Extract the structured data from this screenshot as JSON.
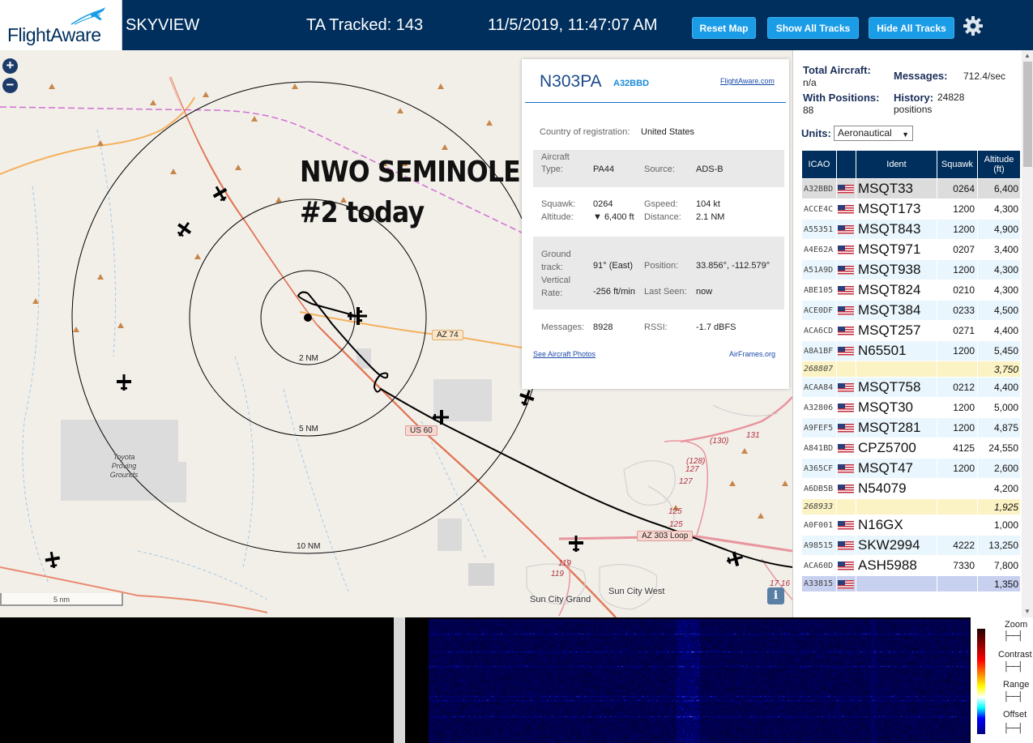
{
  "header": {
    "logo_text": "FlightAware",
    "app_name": "SKYVIEW",
    "tracked": "TA Tracked: 143",
    "clock": "11/5/2019, 11:47:07 AM",
    "buttons": {
      "reset": "Reset Map",
      "show": "Show All Tracks",
      "hide": "Hide All Tracks"
    }
  },
  "map": {
    "zoom_in": "+",
    "zoom_out": "−",
    "annotation_line1": "NWO SEMINOLE",
    "annotation_line2": "#2 today",
    "ring_labels": {
      "r2": "2 NM",
      "r5": "5 NM",
      "r10": "10 NM"
    },
    "roads": {
      "az74": "AZ 74",
      "us60": "US 60",
      "az303": "AZ 303 Loop"
    },
    "route_numbers": {
      "r130": "(130)",
      "r131": "131",
      "r128": "(128)",
      "r127a": "127",
      "r127b": "127",
      "r125a": "125",
      "r125b": "125",
      "r119a": "119",
      "r119b": "119",
      "r1716": "17 16"
    },
    "towns": {
      "toyota": "Toyota Proving Grounds",
      "sun_city_grand": "Sun City Grand",
      "sun_city_west": "Sun City West"
    },
    "scale": "5 nm",
    "info": "i"
  },
  "popup": {
    "registration": "N303PA",
    "hex": "A32BBD",
    "link": "FlightAware.com",
    "country_label": "Country of registration:",
    "country": "United States",
    "aircraft_type_label": "Aircraft Type:",
    "aircraft_type": "PA44",
    "source_label": "Source:",
    "source": "ADS-B",
    "squawk_label": "Squawk:",
    "squawk": "0264",
    "gspeed_label": "Gspeed:",
    "gspeed": "104 kt",
    "altitude_label": "Altitude:",
    "altitude": "▼ 6,400 ft",
    "distance_label": "Distance:",
    "distance": "2.1 NM",
    "ground_track_label": "Ground track:",
    "ground_track": "91° (East)",
    "position_label": "Position:",
    "position": "33.856°, -112.579°",
    "vertical_rate_label": "Vertical Rate:",
    "vertical_rate": "-256 ft/min",
    "last_seen_label": "Last Seen:",
    "last_seen": "now",
    "messages_label": "Messages:",
    "messages": "8928",
    "rssi_label": "RSSI:",
    "rssi": "-1.7 dBFS",
    "photos_link": "See Aircraft Photos",
    "airframes_link": "AirFrames.org"
  },
  "stats": {
    "total_label": "Total Aircraft:",
    "total": "n/a",
    "messages_label": "Messages:",
    "messages": "712.4/sec",
    "positions_label": "With Positions:",
    "positions": "88",
    "history_label": "History:",
    "history": "24828 positions",
    "units_label": "Units:",
    "units_value": "Aeronautical"
  },
  "table": {
    "headers": {
      "icao": "ICAO",
      "flag": "",
      "ident": "Ident",
      "squawk": "Squawk",
      "altitude": "Altitude (ft)"
    },
    "rows": [
      {
        "icao": "A32BBD",
        "ident": "MSQT33",
        "squawk": "0264",
        "alt": "6,400"
      },
      {
        "icao": "ACCE4C",
        "ident": "MSQT173",
        "squawk": "1200",
        "alt": "4,300"
      },
      {
        "icao": "A55351",
        "ident": "MSQT843",
        "squawk": "1200",
        "alt": "4,900"
      },
      {
        "icao": "A4E62A",
        "ident": "MSQT971",
        "squawk": "0207",
        "alt": "3,400"
      },
      {
        "icao": "A51A9D",
        "ident": "MSQT938",
        "squawk": "1200",
        "alt": "4,300"
      },
      {
        "icao": "ABE105",
        "ident": "MSQT824",
        "squawk": "0210",
        "alt": "4,300"
      },
      {
        "icao": "ACE0DF",
        "ident": "MSQT384",
        "squawk": "0233",
        "alt": "4,500"
      },
      {
        "icao": "ACA6CD",
        "ident": "MSQT257",
        "squawk": "0271",
        "alt": "4,400"
      },
      {
        "icao": "A8A1BF",
        "ident": "N65501",
        "squawk": "1200",
        "alt": "5,450"
      },
      {
        "icao": "268807",
        "ident": "",
        "squawk": "",
        "alt": "3,750"
      },
      {
        "icao": "ACAA84",
        "ident": "MSQT758",
        "squawk": "0212",
        "alt": "4,400"
      },
      {
        "icao": "A32806",
        "ident": "MSQT30",
        "squawk": "1200",
        "alt": "5,000"
      },
      {
        "icao": "A9FEF5",
        "ident": "MSQT281",
        "squawk": "1200",
        "alt": "4,875"
      },
      {
        "icao": "A841BD",
        "ident": "CPZ5700",
        "squawk": "4125",
        "alt": "24,550"
      },
      {
        "icao": "A365CF",
        "ident": "MSQT47",
        "squawk": "1200",
        "alt": "2,600"
      },
      {
        "icao": "A6DB5B",
        "ident": "N54079",
        "squawk": "",
        "alt": "4,200"
      },
      {
        "icao": "268933",
        "ident": "",
        "squawk": "",
        "alt": "1,925"
      },
      {
        "icao": "A0F001",
        "ident": "N16GX",
        "squawk": "",
        "alt": "1,000"
      },
      {
        "icao": "A98515",
        "ident": "SKW2994",
        "squawk": "4222",
        "alt": "13,250"
      },
      {
        "icao": "ACA60D",
        "ident": "ASH5988",
        "squawk": "7330",
        "alt": "7,800"
      },
      {
        "icao": "A33815",
        "ident": "",
        "squawk": "",
        "alt": "1,350"
      }
    ]
  },
  "spectrum": {
    "zoom_label": "Zoom",
    "contrast_label": "Contrast",
    "range_label": "Range",
    "offset_label": "Offset"
  },
  "colors": {
    "header_bg": "#002f5d",
    "button_bg": "#1b9ce6",
    "row_selected": "#dcdcdc",
    "row_no_position": "#fbf3c4",
    "row_other": "#c8d0f0"
  }
}
